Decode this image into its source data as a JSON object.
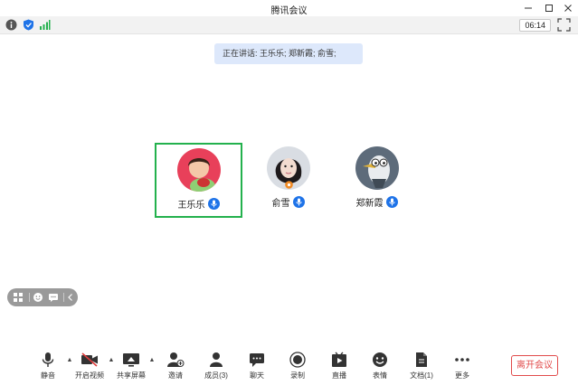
{
  "window": {
    "title": "腾讯会议"
  },
  "status": {
    "timer": "06:14"
  },
  "speaking": {
    "text": "正在讲话: 王乐乐; 郑新霞; 俞雪;"
  },
  "participants": [
    {
      "name": "王乐乐",
      "active": true
    },
    {
      "name": "俞雪",
      "active": false
    },
    {
      "name": "郑新霞",
      "active": false
    }
  ],
  "toolbar": {
    "items": [
      {
        "label": "静音",
        "icon": "microphone-icon"
      },
      {
        "label": "开启视频",
        "icon": "video-off-icon"
      },
      {
        "label": "共享屏幕",
        "icon": "share-screen-icon"
      },
      {
        "label": "邀请",
        "icon": "invite-icon"
      },
      {
        "label": "成员(3)",
        "icon": "members-icon"
      },
      {
        "label": "聊天",
        "icon": "chat-icon"
      },
      {
        "label": "录制",
        "icon": "record-icon"
      },
      {
        "label": "直播",
        "icon": "live-icon"
      },
      {
        "label": "表情",
        "icon": "emoji-icon"
      },
      {
        "label": "文档(1)",
        "icon": "document-icon"
      },
      {
        "label": "更多",
        "icon": "more-icon"
      }
    ],
    "leave_label": "离开会议"
  },
  "colors": {
    "active_border": "#23b14d",
    "mic_badge": "#1e73e8",
    "leave": "#e14b4b",
    "speaking_bg": "#dde8fb"
  }
}
